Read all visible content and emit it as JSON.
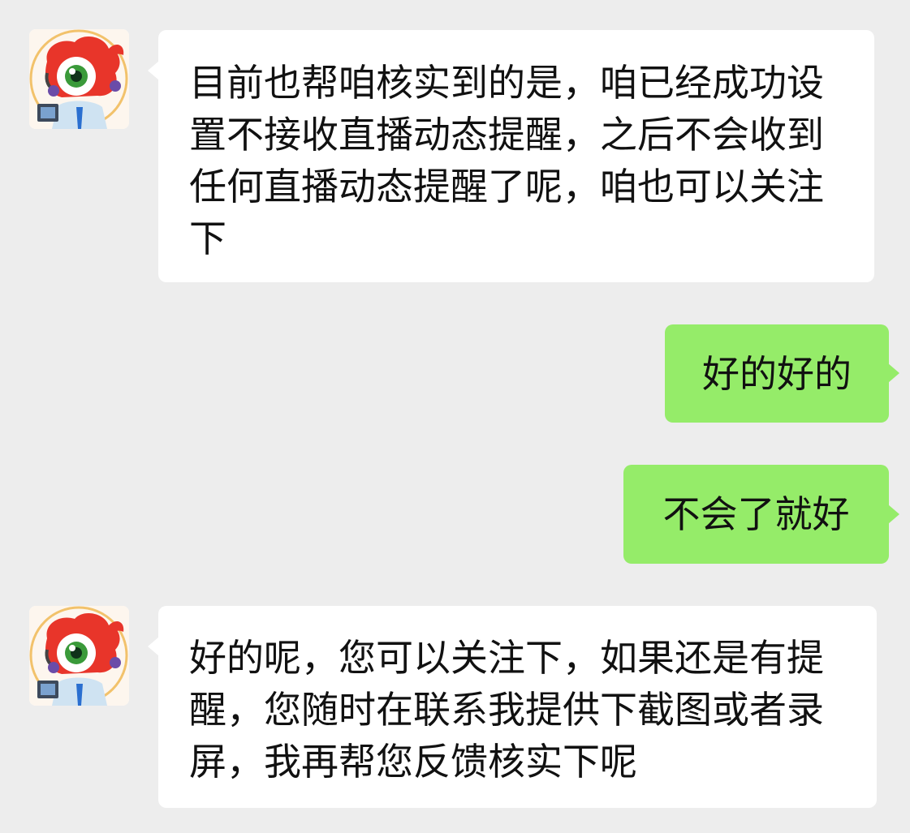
{
  "colors": {
    "background": "#ededed",
    "incoming_bubble": "#ffffff",
    "outgoing_bubble": "#95ec69"
  },
  "messages": [
    {
      "side": "incoming",
      "avatar_icon": "red-mascot-customer-service-avatar-icon",
      "text": "目前也帮咱核实到的是，咱已经成功设置不接收直播动态提醒，之后不会收到任何直播动态提醒了呢，咱也可以关注下"
    },
    {
      "side": "outgoing",
      "text": "好的好的"
    },
    {
      "side": "outgoing",
      "text": "不会了就好"
    },
    {
      "side": "incoming",
      "avatar_icon": "red-mascot-customer-service-avatar-icon",
      "text": "好的呢，您可以关注下，如果还是有提醒，您随时在联系我提供下截图或者录屏，我再帮您反馈核实下呢"
    }
  ]
}
